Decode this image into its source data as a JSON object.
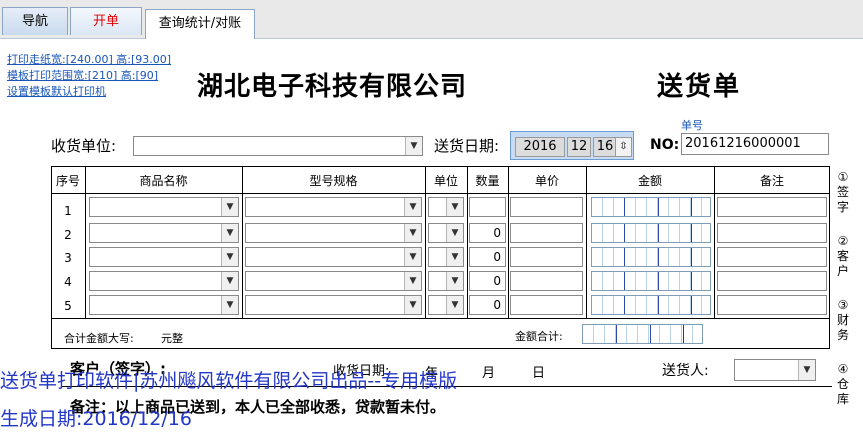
{
  "tabs": {
    "nav": "导航",
    "order": "开单",
    "query": "查询统计/对账"
  },
  "links": {
    "paper": "打印走纸宽:[240.00] 高:[93.00]",
    "range": "模板打印范围宽:[210] 高:[90]",
    "default_printer": "设置模板默认打印机"
  },
  "company": "湖北电子科技有限公司",
  "doc_title": "送货单",
  "receiver_label": "收货单位:",
  "date_label": "送货日期:",
  "date": {
    "year": "2016",
    "month": "12",
    "day": "16"
  },
  "no_caption": "单号",
  "no_label": "NO:",
  "no_value": "20161216000001",
  "headers": [
    "序号",
    "商品名称",
    "型号规格",
    "单位",
    "数量",
    "单价",
    "金额",
    "备注"
  ],
  "rows": [
    {
      "num": "1",
      "qty": ""
    },
    {
      "num": "2",
      "qty": "0"
    },
    {
      "num": "3",
      "qty": "0"
    },
    {
      "num": "4",
      "qty": "0"
    },
    {
      "num": "5",
      "qty": "0"
    }
  ],
  "total_upper_label": "合计金额大写:",
  "total_upper_value": "元整",
  "total_label": "金额合计:",
  "customer_sign": "客户（签字）:",
  "receipt_date": "收货日期:",
  "year_char": "年",
  "month_char": "月",
  "day_char": "日",
  "sender_label": "送货人:",
  "note": "备注：以上商品已送到，本人已全部收悉，贷款暂未付。",
  "side_notes": [
    "①签字",
    "②客户",
    "③财务",
    "④仓库"
  ],
  "watermark1": "送货单打印软件|苏州飚风软件有限公司出品--专用模版",
  "watermark2": "生成日期:2016/12/16"
}
